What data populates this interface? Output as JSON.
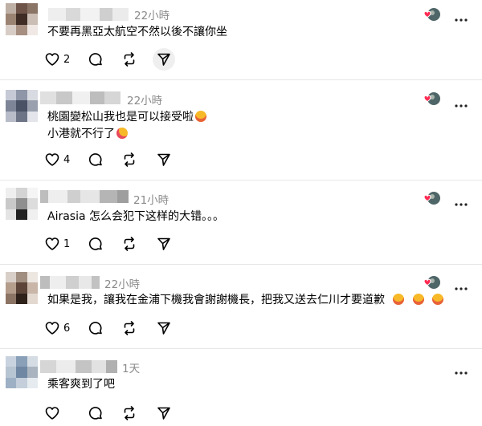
{
  "colors": {
    "text": "#000000",
    "muted": "#8a8a8a",
    "divider": "#e6e6e6",
    "heart": "#ff2a52"
  },
  "icons": {
    "like": "heart-outline-icon",
    "reply": "speech-bubble-icon",
    "repost": "repost-arrows-icon",
    "share": "paper-plane-icon",
    "more": "more-dots-icon",
    "liked_badge": "heart-badge-icon"
  },
  "posts": [
    {
      "time": "22小時",
      "lines": [
        "不要再黑亞太航空不然以後不讓你坐"
      ],
      "emojis": [],
      "like_count": "2"
    },
    {
      "time": "22小時",
      "lines": [
        "桃園變松山我也是可以接受啦",
        "小港就不行了"
      ],
      "emojis": [
        "rolling-laughing-emoji",
        "smiling-hearts-emoji"
      ],
      "like_count": "4"
    },
    {
      "time": "21小時",
      "lines": [
        "Airasia 怎么会犯下这样的大错。。。"
      ],
      "emojis": [],
      "like_count": "1"
    },
    {
      "time": "22小時",
      "lines": [
        "如果是我，讓我在金浦下機我會謝謝機長，把我又送去仁川才要道歉"
      ],
      "emojis": [
        "rolling-laughing-emoji",
        "rolling-laughing-emoji",
        "rolling-laughing-emoji"
      ],
      "like_count": "6"
    },
    {
      "time": "1天",
      "lines": [
        "乘客爽到了吧"
      ],
      "emojis": [],
      "like_count": ""
    }
  ]
}
